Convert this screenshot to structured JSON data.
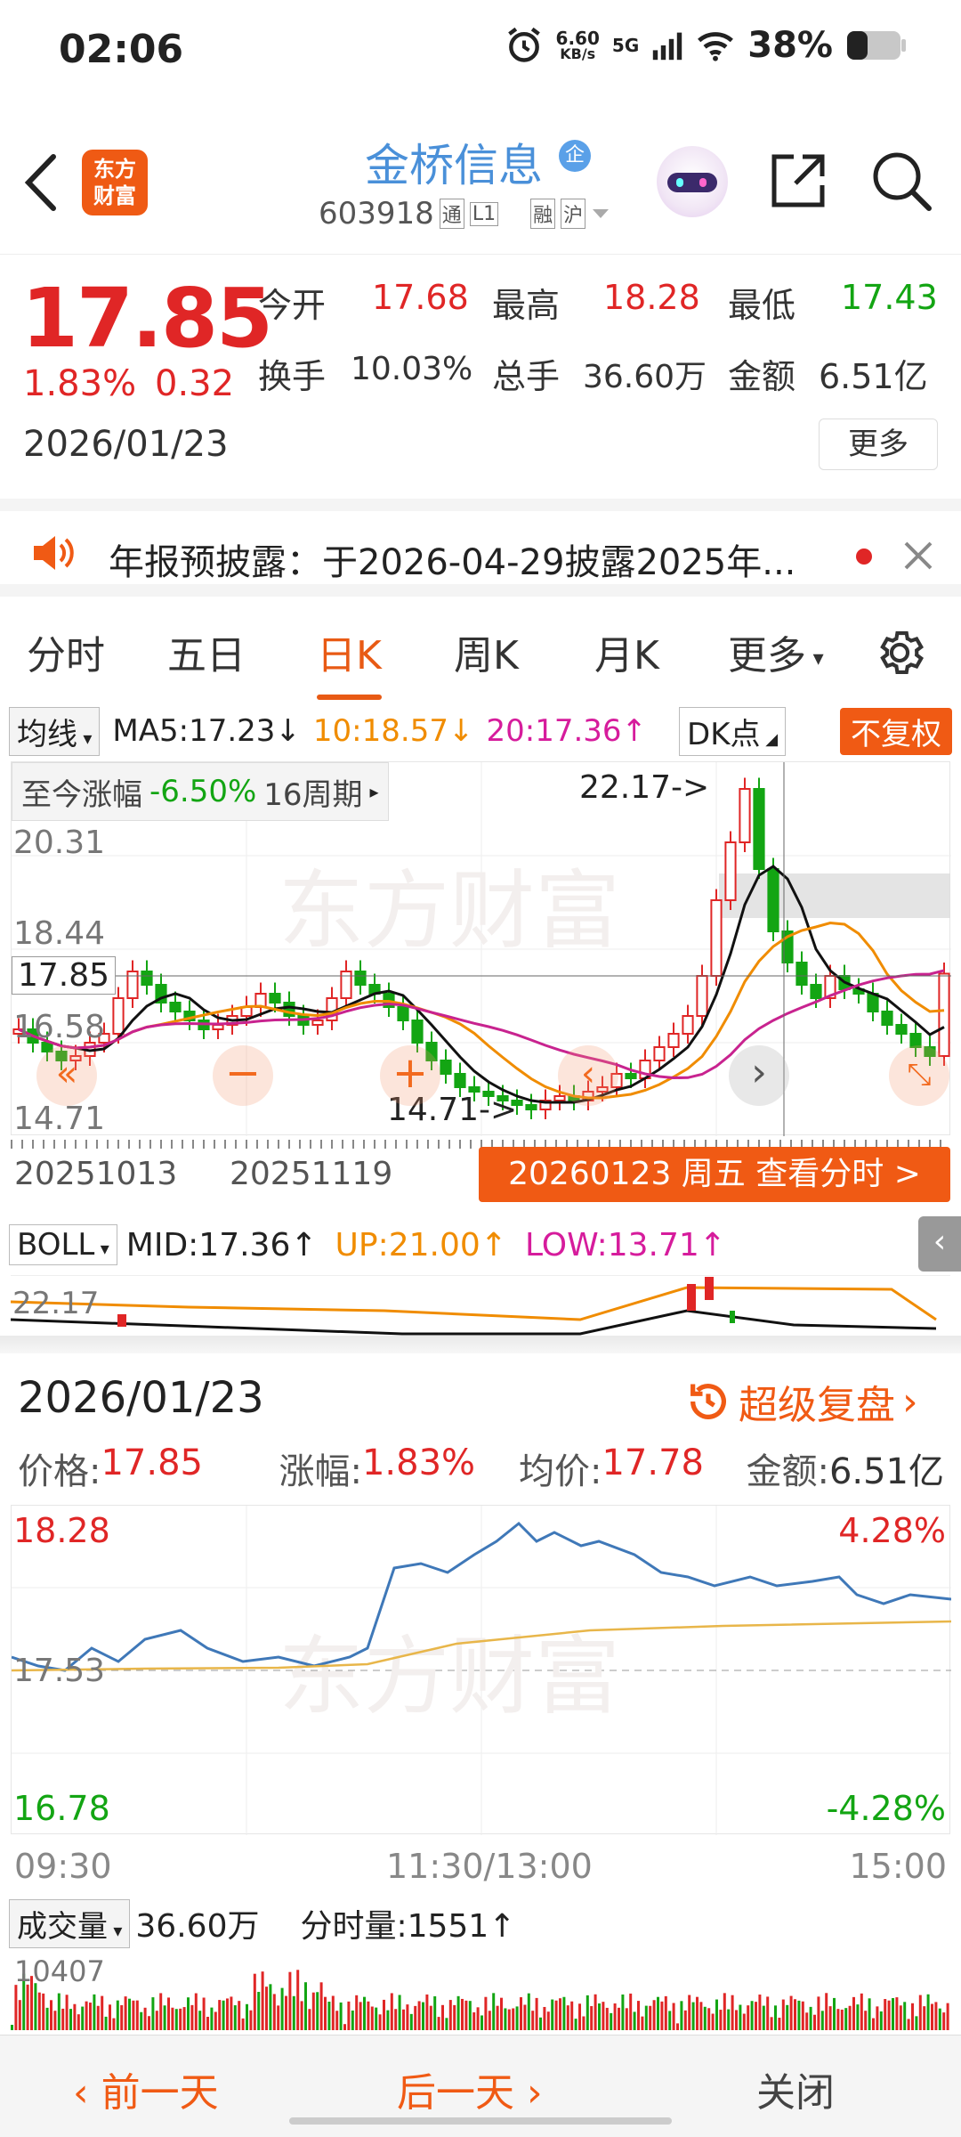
{
  "statusbar": {
    "time": "02:06",
    "net_speed": "6.60",
    "net_unit": "KB/s",
    "network": "5G",
    "battery": "38%"
  },
  "header": {
    "stock_name": "金桥信息",
    "stock_code": "603918",
    "tag_tong": "通",
    "tag_l1": "L1",
    "tag_rong": "融",
    "tag_hu": "沪",
    "enterprise_badge": "企",
    "logo_line1": "东方",
    "logo_line2": "财富"
  },
  "quote": {
    "price": "17.85",
    "change_pct": "1.83%",
    "change_amt": "0.32",
    "date": "2026/01/23",
    "open_label": "今开",
    "open": "17.68",
    "high_label": "最高",
    "high": "18.28",
    "low_label": "最低",
    "low": "17.43",
    "turnover_label": "换手",
    "turnover": "10.03%",
    "volume_label": "总手",
    "volume": "36.60万",
    "amount_label": "金额",
    "amount": "6.51亿",
    "more_label": "更多"
  },
  "notice": {
    "text": "年报预披露：于2026-04-29披露2025年..."
  },
  "tabs": [
    {
      "label": "分时"
    },
    {
      "label": "五日"
    },
    {
      "label": "日K"
    },
    {
      "label": "周K"
    },
    {
      "label": "月K"
    },
    {
      "label": "更多"
    }
  ],
  "kline": {
    "ma_select": "均线",
    "ma5": "MA5:17.23",
    "ma5_arrow": "↓",
    "ma10": "10:18.57",
    "ma10_arrow": "↓",
    "ma20": "20:17.36",
    "ma20_arrow": "↑",
    "dk_label": "DK点",
    "fq_label": "不复权",
    "range_label": "至今涨幅",
    "range_value": "-6.50%",
    "range_period": "16周期",
    "y_labels": [
      "20.31",
      "18.44",
      "16.58",
      "14.71"
    ],
    "current_label": "17.85",
    "max_annot": "22.17->",
    "min_annot": "14.71->",
    "date_start": "20251013",
    "date_mid": "20251119",
    "selected_date_label": "20260123 周五 查看分时 >",
    "colors": {
      "up": "#e02626",
      "down": "#13a513",
      "ma5": "#111111",
      "ma10": "#f08c00",
      "ma20": "#c8238f"
    }
  },
  "boll": {
    "select": "BOLL",
    "mid": "MID:17.36",
    "mid_arrow": "↑",
    "up": "UP:21.00",
    "up_arrow": "↑",
    "low": "LOW:13.71",
    "low_arrow": "↑",
    "y_label": "22.17"
  },
  "detail": {
    "date": "2026/01/23",
    "super_review": "超级复盘",
    "price_label": "价格:",
    "price": "17.85",
    "pct_label": "涨幅:",
    "pct": "1.83%",
    "avg_label": "均价:",
    "avg": "17.78",
    "amount_label": "金额:",
    "amount": "6.51亿"
  },
  "timechart": {
    "y_top": "18.28",
    "y_mid": "17.53",
    "y_bottom": "16.78",
    "pct_top": "4.28%",
    "pct_bottom": "-4.28%",
    "x_start": "09:30",
    "x_mid": "11:30/13:00",
    "x_end": "15:00"
  },
  "volume": {
    "select": "成交量",
    "total": "36.60万",
    "minute_label": "分时量:1551",
    "minute_arrow": "↑",
    "y_label": "10407"
  },
  "bottombar": {
    "prev": "前一天",
    "next": "后一天",
    "close": "关闭"
  }
}
